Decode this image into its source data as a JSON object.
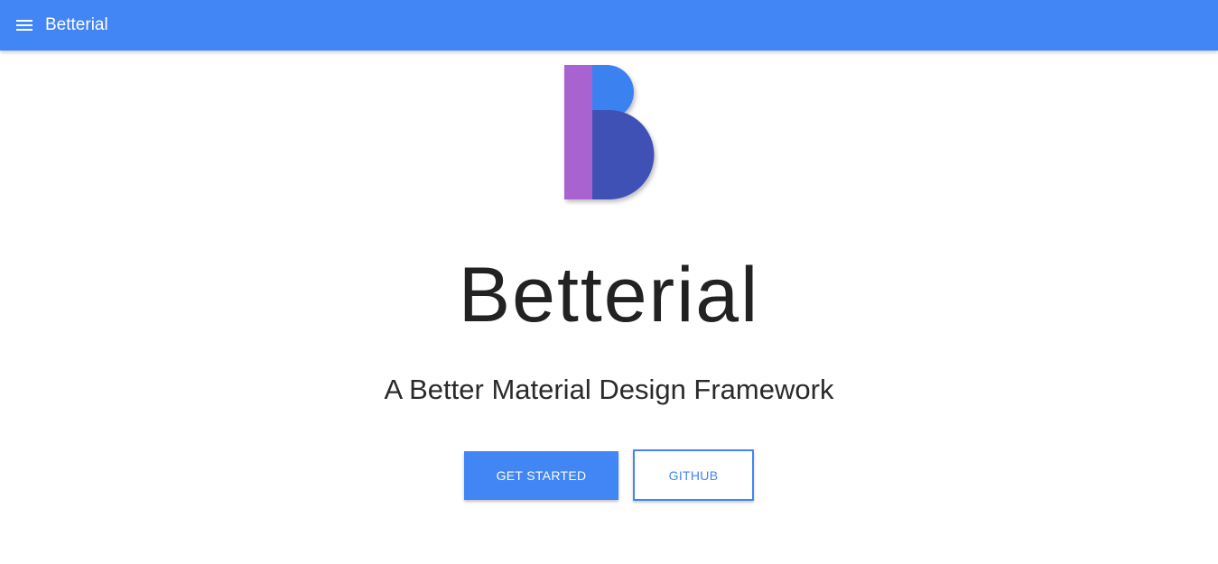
{
  "appbar": {
    "title": "Betterial",
    "menu_icon": "menu-icon"
  },
  "hero": {
    "logo_icon": "betterial-logo",
    "title": "Betterial",
    "subtitle": "A Better Material Design Framework"
  },
  "actions": {
    "primary_label": "GET STARTED",
    "secondary_label": "GITHUB"
  },
  "colors": {
    "primary": "#4285f4",
    "logo_bar": "#a863d0",
    "logo_top": "#3b82f0",
    "logo_bottom": "#3f51b5",
    "text": "#1a1a1a"
  }
}
